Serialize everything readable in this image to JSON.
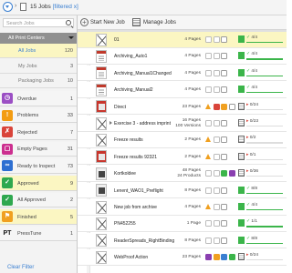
{
  "topbar": {
    "jobs_label": "15 Jobs",
    "filtered_label": "[filtered x]"
  },
  "search": {
    "placeholder": "Search Jobs"
  },
  "sidebar": {
    "print_centers_label": "All Print Centers",
    "categories": [
      {
        "label": "All Jobs",
        "count": "120",
        "highlight": true
      },
      {
        "label": "My Jobs",
        "count": "3",
        "highlight": false
      },
      {
        "label": "Packaging Jobs",
        "count": "10",
        "highlight": false
      }
    ],
    "statuses": [
      {
        "label": "Overdue",
        "count": "1",
        "color": "#9b4fc4",
        "icon": "clock-icon",
        "glyph": "◷",
        "yellow": false
      },
      {
        "label": "Problems",
        "count": "33",
        "color": "#f39c12",
        "icon": "warning-icon",
        "glyph": "!",
        "yellow": false
      },
      {
        "label": "Rejected",
        "count": "7",
        "color": "#d9443a",
        "icon": "thumbs-down-icon",
        "glyph": "✗",
        "yellow": false
      },
      {
        "label": "Empty Pages",
        "count": "31",
        "color": "#cc2f8f",
        "icon": "empty-page-icon",
        "glyph": "▢",
        "yellow": false
      },
      {
        "label": "Ready to Inspect",
        "count": "73",
        "color": "#2e6fd1",
        "icon": "inspect-icon",
        "glyph": "∞",
        "yellow": false
      },
      {
        "label": "Approved",
        "count": "9",
        "color": "#2fa84f",
        "icon": "check-icon",
        "glyph": "✓",
        "yellow": true
      },
      {
        "label": "All Approved",
        "count": "2",
        "color": "#2fa84f",
        "icon": "check-all-icon",
        "glyph": "✓",
        "yellow": false
      },
      {
        "label": "Finished",
        "count": "5",
        "color": "#f0a020",
        "icon": "flag-icon",
        "glyph": "⚑",
        "yellow": true
      },
      {
        "label": "PressTune",
        "count": "1",
        "color": "#f5f5f5",
        "icon": "presstune-icon",
        "glyph": "PT",
        "yellow": false
      }
    ],
    "clear_filter": "Clear Filter"
  },
  "toolbar": {
    "new_job": "Start New Job",
    "manage_jobs": "Manage Jobs"
  },
  "jobs": [
    {
      "name": "01",
      "pages": "4 Pages",
      "pages2": "",
      "progress": "4/4",
      "state": "ok",
      "thumb": "x",
      "expand": false,
      "sel": true,
      "icons": [
        "w",
        "w",
        "o"
      ]
    },
    {
      "name": "Archiving_Auto1",
      "pages": "4 Pages",
      "pages2": "",
      "progress": "4/4",
      "state": "ok",
      "thumb": "doc",
      "expand": false,
      "sel": false,
      "icons": [
        "w",
        "w",
        "o"
      ]
    },
    {
      "name": "Archiving_Manual1Changed",
      "pages": "4 Pages",
      "pages2": "",
      "progress": "4/4",
      "state": "ok",
      "thumb": "doc",
      "expand": false,
      "sel": false,
      "icons": [
        "w",
        "w",
        "o"
      ]
    },
    {
      "name": "Archiving_Manual2",
      "pages": "4 Pages",
      "pages2": "",
      "progress": "4/4",
      "state": "ok",
      "thumb": "doc",
      "expand": false,
      "sel": false,
      "icons": [
        "w",
        "w",
        "o"
      ]
    },
    {
      "name": "Direct",
      "pages": "23 Pages",
      "pages2": "",
      "progress": "0/24",
      "state": "err",
      "thumb": "red",
      "expand": false,
      "sel": false,
      "icons": [
        "tri",
        "red",
        "orange",
        "o"
      ]
    },
    {
      "name": "Exercise 3 - address imprint",
      "pages": "16 Pages",
      "pages2": "100 Versions",
      "progress": "0/23",
      "state": "err",
      "thumb": "x",
      "expand": true,
      "sel": false,
      "icons": [
        "w",
        "w",
        "o"
      ]
    },
    {
      "name": "Freeze results",
      "pages": "2 Pages",
      "pages2": "",
      "progress": "0/2",
      "state": "err",
      "thumb": "x",
      "expand": false,
      "sel": false,
      "icons": [
        "tri",
        "w",
        "o"
      ]
    },
    {
      "name": "Freeze results 92321",
      "pages": "2 Pages",
      "pages2": "",
      "progress": "0/1",
      "state": "err",
      "thumb": "red",
      "expand": false,
      "sel": false,
      "icons": [
        "tri",
        "w",
        "o"
      ]
    },
    {
      "name": "Kortkoldee",
      "pages": "48 Pages",
      "pages2": "24 Products",
      "progress": "0/36",
      "state": "err",
      "thumb": "gray",
      "expand": false,
      "sel": false,
      "icons": [
        "w",
        "w",
        "green",
        "purple"
      ]
    },
    {
      "name": "Lenent_WAO1_Preflight",
      "pages": "8 Pages",
      "pages2": "",
      "progress": "8/8",
      "state": "ok",
      "thumb": "gray",
      "expand": false,
      "sel": false,
      "icons": [
        "w",
        "w",
        "o"
      ]
    },
    {
      "name": "New job from archive",
      "pages": "4 Pages",
      "pages2": "",
      "progress": "4/4",
      "state": "ok",
      "thumb": "x",
      "expand": false,
      "sel": false,
      "icons": [
        "tri",
        "w",
        "o"
      ]
    },
    {
      "name": "PN452255",
      "pages": "1 Page",
      "pages2": "",
      "progress": "1/1",
      "state": "ok",
      "thumb": "x",
      "expand": false,
      "sel": false,
      "icons": [
        "w",
        "w",
        "o"
      ]
    },
    {
      "name": "ReaderSpreads_RightBinding",
      "pages": "8 Pages",
      "pages2": "",
      "progress": "8/8",
      "state": "ok",
      "thumb": "x",
      "expand": false,
      "sel": false,
      "icons": [
        "w",
        "w",
        "o"
      ]
    },
    {
      "name": "WebProof Action",
      "pages": "23 Pages",
      "pages2": "",
      "progress": "0/24",
      "state": "err",
      "thumb": "x",
      "expand": false,
      "sel": false,
      "icons": [
        "purple",
        "orange",
        "blue",
        "green"
      ]
    }
  ]
}
